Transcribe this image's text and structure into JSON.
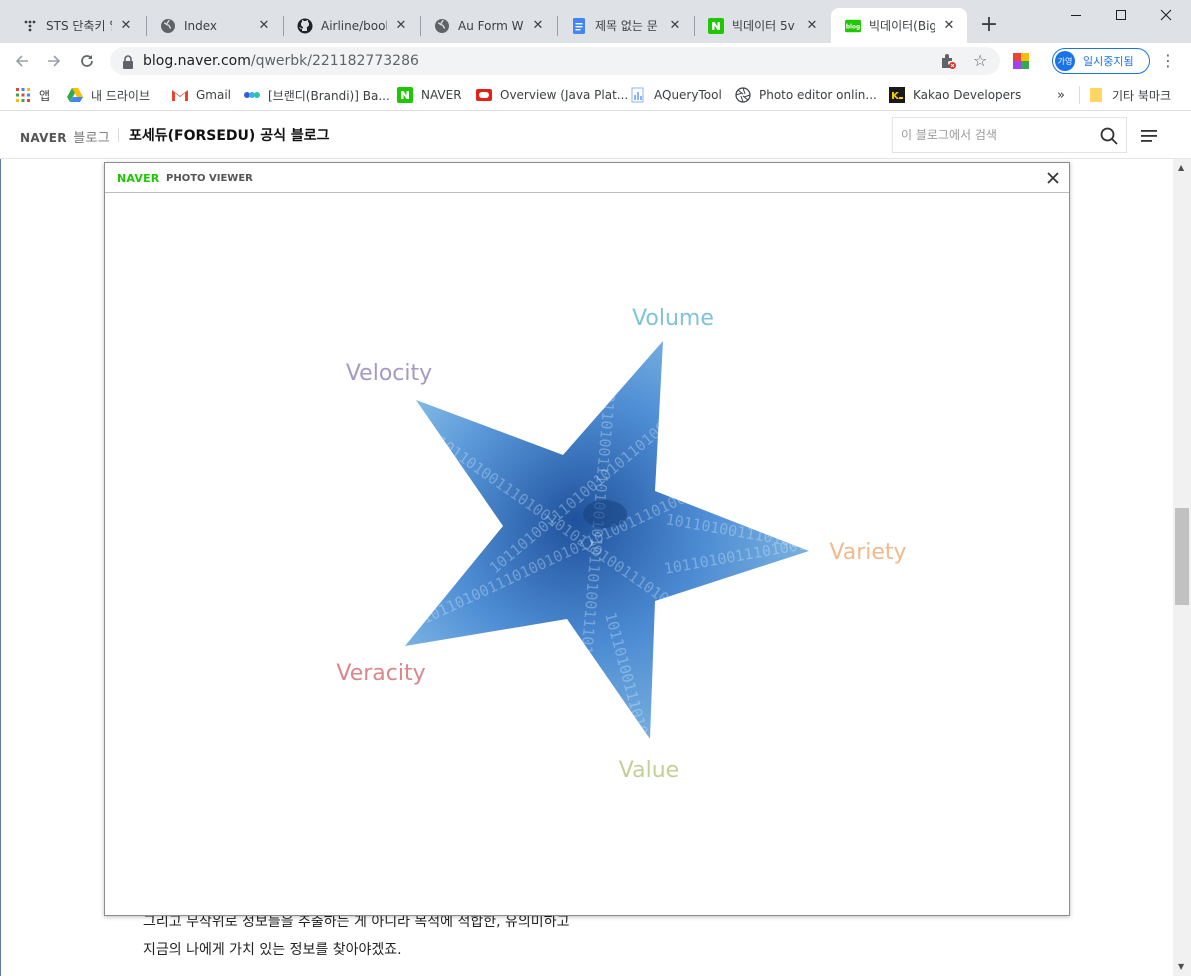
{
  "tabs": [
    {
      "title": "STS 단축키 일",
      "favicon": "dots-icon",
      "active": false
    },
    {
      "title": "Index",
      "favicon": "globe-icon",
      "active": false
    },
    {
      "title": "Airline/booki",
      "favicon": "github-icon",
      "active": false
    },
    {
      "title": "Au Form Wiz",
      "favicon": "globe-icon",
      "active": false
    },
    {
      "title": "제목 없는 문",
      "favicon": "docs-icon",
      "active": false
    },
    {
      "title": "빅데이터 5v",
      "favicon": "naver-n-icon",
      "active": false
    },
    {
      "title": "빅데이터(Big",
      "favicon": "blog-icon",
      "active": true
    }
  ],
  "address": {
    "host": "blog.naver.com",
    "path": "/qwerbk/221182773286"
  },
  "profile": {
    "avatar": "가영",
    "label": "일시중지됨"
  },
  "bookmarks": [
    {
      "label": "앱",
      "icon": "apps-grid-icon"
    },
    {
      "label": "내 드라이브",
      "icon": "drive-icon"
    },
    {
      "label": "Gmail",
      "icon": "gmail-icon"
    },
    {
      "label": "[브랜디(Brandi)] Ba...",
      "icon": "brandi-icon"
    },
    {
      "label": "NAVER",
      "icon": "naver-n-icon"
    },
    {
      "label": "Overview (Java Plat...",
      "icon": "oracle-icon"
    },
    {
      "label": "AQueryTool",
      "icon": "doc-icon"
    },
    {
      "label": "Photo editor onlin...",
      "icon": "aperture-icon"
    },
    {
      "label": "Kakao Developers",
      "icon": "kakao-icon"
    },
    {
      "label": "기타 북마크",
      "icon": "folder-icon"
    }
  ],
  "bookmarks_overflow": "»",
  "blog": {
    "logo": "NAVER",
    "logo_suffix": "블로그",
    "title": "포세듀(FORSEDU) 공식 블로그",
    "search_placeholder": "이 블로그에서 검색"
  },
  "body_lines": [
    "그리고 무작위로 정보들을 추출하는 게 아니라 목적에 적합한, 유의미하고",
    "지금의 나에게 가치 있는 정보를 찾아야겠죠."
  ],
  "viewer": {
    "brand": "NAVER",
    "subtitle": "PHOTO VIEWER",
    "image_labels": {
      "volume": "Volume",
      "velocity": "Velocity",
      "variety": "Variety",
      "veracity": "Veracity",
      "value": "Value"
    },
    "label_colors": {
      "volume": "#7fc3d8",
      "velocity": "#a49ac4",
      "variety": "#f2b98a",
      "veracity": "#d9868c",
      "value": "#c3cf95"
    },
    "star_colors": [
      "#a8dcf5",
      "#4f8ed6",
      "#1d4f99"
    ],
    "binary_text": "1011010011101001010110100111010010"
  },
  "colors": {
    "accent": "#1a73e8",
    "naver_green": "#1ec800"
  }
}
